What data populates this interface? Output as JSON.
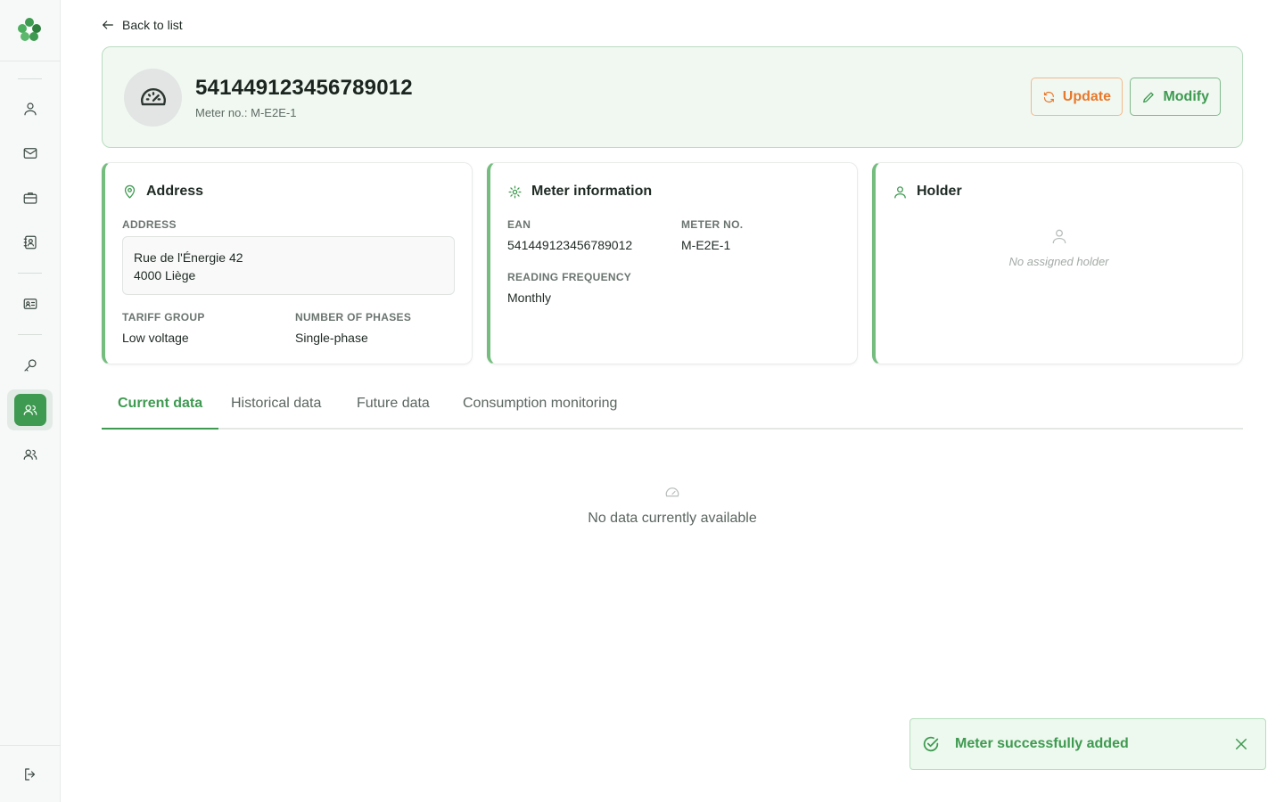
{
  "sidebar": {
    "logo_icon": "clover-logo",
    "items": [
      {
        "icon": "user-icon"
      },
      {
        "icon": "mail-icon"
      },
      {
        "icon": "briefcase-icon"
      },
      {
        "icon": "contact-book-icon"
      },
      {
        "icon": "id-card-icon"
      },
      {
        "icon": "key-icon"
      },
      {
        "icon": "users-icon",
        "active": true
      },
      {
        "icon": "users-icon"
      }
    ],
    "logout_icon": "logout-icon"
  },
  "back_link": {
    "label": "Back to list"
  },
  "meter": {
    "ean": "541449123456789012",
    "meter_no_line": "Meter no.: M-E2E-1"
  },
  "actions": {
    "update_label": "Update",
    "modify_label": "Modify"
  },
  "address_card": {
    "title": "Address",
    "address_label": "ADDRESS",
    "address_line1": "Rue de l'Énergie 42",
    "address_line2": "4000 Liège",
    "tariff_group_label": "TARIFF GROUP",
    "tariff_group_value": "Low voltage",
    "phases_label": "NUMBER OF PHASES",
    "phases_value": "Single-phase"
  },
  "meter_card": {
    "title": "Meter information",
    "ean_label": "EAN",
    "ean_value": "541449123456789012",
    "meter_no_label": "METER NO.",
    "meter_no_value": "M-E2E-1",
    "frequency_label": "READING FREQUENCY",
    "frequency_value": "Monthly"
  },
  "holder_card": {
    "title": "Holder",
    "empty_text": "No assigned holder"
  },
  "tabs": [
    {
      "label": "Current data",
      "active": true
    },
    {
      "label": "Historical data"
    },
    {
      "label": "Future data"
    },
    {
      "label": "Consumption monitoring"
    }
  ],
  "content": {
    "empty_text": "No data currently available"
  },
  "toast": {
    "message": "Meter successfully added"
  },
  "colors": {
    "brand_green": "#3e9a50",
    "update_orange": "#e8782a",
    "header_bg": "#f1f8f2"
  }
}
